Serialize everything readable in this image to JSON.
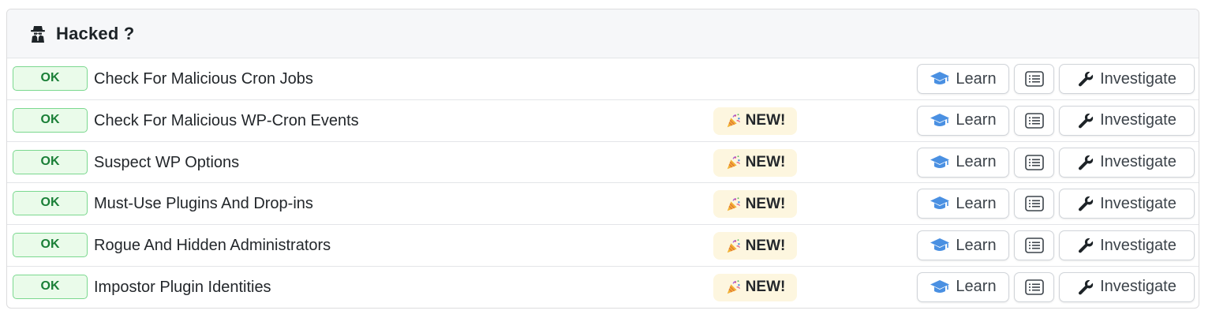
{
  "panel": {
    "title": "Hacked ?",
    "title_icon": "spy-icon"
  },
  "colors": {
    "ok_border": "#7bd88f",
    "ok_bg": "#eafbea",
    "ok_text": "#1a7f37",
    "new_bg": "#fdf6df",
    "learn_icon": "#4a90e2"
  },
  "actions": {
    "learn_label": "Learn",
    "investigate_label": "Investigate",
    "list_icon": "list-icon",
    "learn_icon": "graduation-cap-icon",
    "investigate_icon": "wrench-icon"
  },
  "rows": [
    {
      "status": "OK",
      "label": "Check For Malicious Cron Jobs",
      "badge": ""
    },
    {
      "status": "OK",
      "label": "Check For Malicious WP-Cron Events",
      "badge": "NEW!"
    },
    {
      "status": "OK",
      "label": "Suspect WP Options",
      "badge": "NEW!"
    },
    {
      "status": "OK",
      "label": "Must-Use Plugins And Drop-ins",
      "badge": "NEW!"
    },
    {
      "status": "OK",
      "label": "Rogue And Hidden Administrators",
      "badge": "NEW!"
    },
    {
      "status": "OK",
      "label": "Impostor Plugin Identities",
      "badge": "NEW!"
    }
  ]
}
